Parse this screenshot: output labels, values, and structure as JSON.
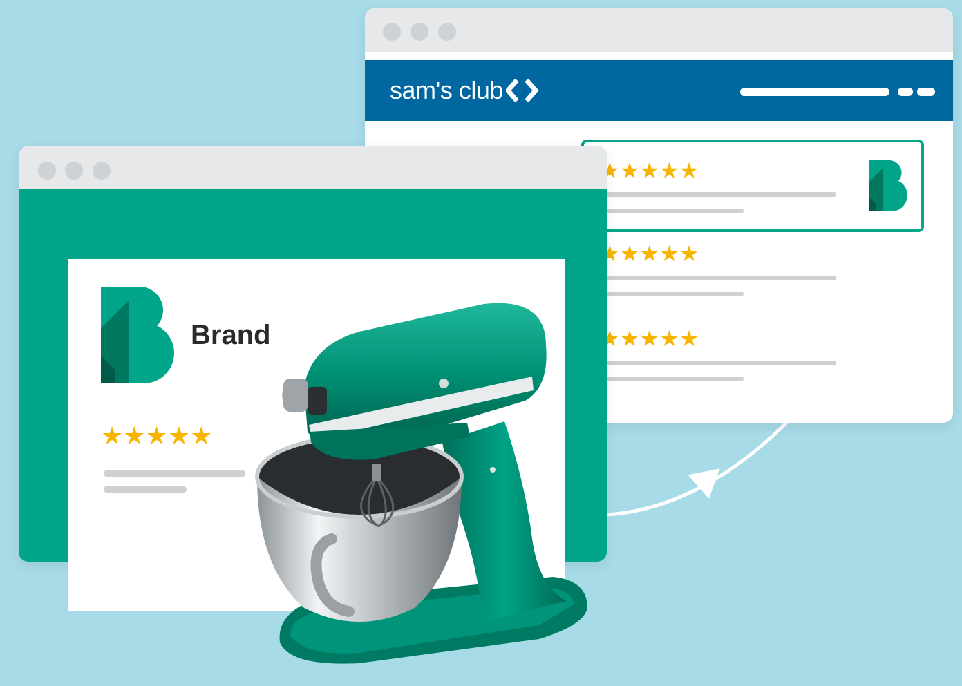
{
  "sams_window": {
    "logo_text": "sam's club",
    "reviews": [
      {
        "stars": "★★★★★",
        "highlighted": true
      },
      {
        "stars": "★★★★★",
        "highlighted": false
      },
      {
        "stars": "★★★★★",
        "highlighted": false
      }
    ]
  },
  "brand_window": {
    "brand_name": "Brand",
    "stars": "★★★★★"
  },
  "colors": {
    "background": "#a7dbe8",
    "brand_green": "#00a58a",
    "sams_blue": "#0067a0",
    "star": "#f7b500"
  },
  "icons": [
    "brand-b-logo-icon",
    "sams-club-diamond-icon",
    "sync-arrow-icon",
    "stand-mixer-image"
  ]
}
